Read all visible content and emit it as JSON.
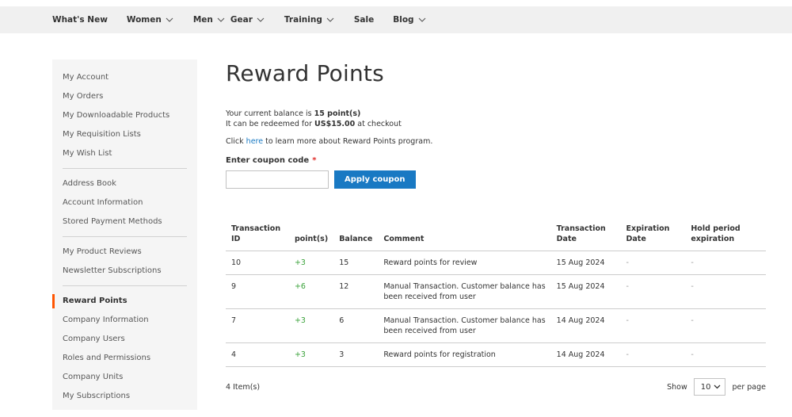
{
  "nav": [
    {
      "label": "What's New",
      "dropdown": false
    },
    {
      "label": "Women",
      "dropdown": true
    },
    {
      "label": "Men",
      "dropdown": true
    },
    {
      "label": "Gear",
      "dropdown": true
    },
    {
      "label": "Training",
      "dropdown": true
    },
    {
      "label": "Sale",
      "dropdown": false
    },
    {
      "label": "Blog",
      "dropdown": true
    }
  ],
  "sidebar": {
    "group1": [
      "My Account",
      "My Orders",
      "My Downloadable Products",
      "My Requisition Lists",
      "My Wish List"
    ],
    "group2": [
      "Address Book",
      "Account Information",
      "Stored Payment Methods"
    ],
    "group3": [
      "My Product Reviews",
      "Newsletter Subscriptions"
    ],
    "group4": [
      "Reward Points",
      "Company Information",
      "Company Users",
      "Roles and Permissions",
      "Company Units",
      "My Subscriptions"
    ],
    "active": "Reward Points"
  },
  "page": {
    "title": "Reward Points",
    "balance_prefix": "Your current balance is ",
    "balance_value": "15 point(s)",
    "redeem_prefix": "It can be redeemed for ",
    "redeem_value": "US$15.00",
    "redeem_suffix": " at checkout",
    "learn_prefix": "Click ",
    "learn_link": "here",
    "learn_suffix": " to learn more about Reward Points program.",
    "coupon_label": "Enter coupon code",
    "coupon_required": "*",
    "coupon_value": "",
    "apply_label": "Apply coupon"
  },
  "table": {
    "headers": [
      "Transaction ID",
      "point(s)",
      "Balance",
      "Comment",
      "Transaction Date",
      "Expiration Date",
      "Hold period expiration"
    ],
    "rows": [
      {
        "id": "10",
        "points": "+3",
        "balance": "15",
        "comment": "Reward points for review",
        "date": "15 Aug 2024",
        "expiration": "-",
        "hold": "-"
      },
      {
        "id": "9",
        "points": "+6",
        "balance": "12",
        "comment": "Manual Transaction. Customer balance has been received from user",
        "date": "15 Aug 2024",
        "expiration": "-",
        "hold": "-"
      },
      {
        "id": "7",
        "points": "+3",
        "balance": "6",
        "comment": "Manual Transaction. Customer balance has been received from user",
        "date": "14 Aug 2024",
        "expiration": "-",
        "hold": "-"
      },
      {
        "id": "4",
        "points": "+3",
        "balance": "3",
        "comment": "Reward points for registration",
        "date": "14 Aug 2024",
        "expiration": "-",
        "hold": "-"
      }
    ]
  },
  "footer": {
    "items_count": "4 Item(s)",
    "show_label": "Show",
    "per_page_value": "10",
    "per_page_label": "per page"
  },
  "colors": {
    "accent": "#1979c3",
    "active_marker": "#ff5501",
    "points_positive": "#3aa23a"
  }
}
